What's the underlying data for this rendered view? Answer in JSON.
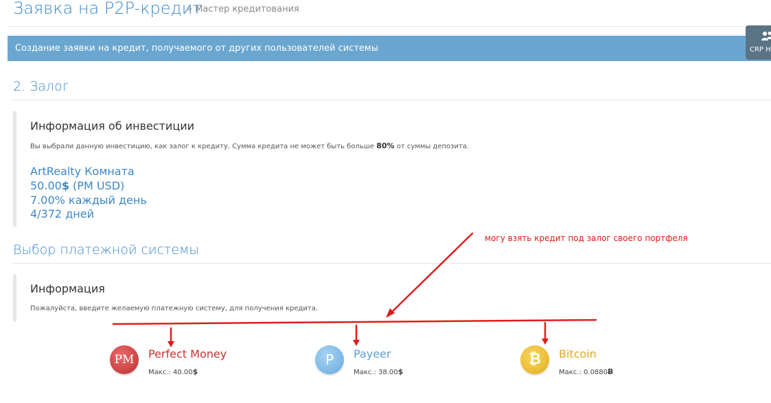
{
  "header": {
    "title": "Заявка на P2P-кредит",
    "breadcrumb": "» Мастер кредитования"
  },
  "banner": {
    "text": "Создание заявки на кредит, получаемого от других пользователей системы"
  },
  "side_tab": {
    "label": "CRP H",
    "icon": "users-icon"
  },
  "collateral": {
    "title_number": "2.",
    "title": "Залог",
    "info_heading": "Информация об инвестиции",
    "info_text_before": "Вы выбрали данную инвестицию, как залог к кредиту. Сумма кредита не может быть больше",
    "info_text_percent": "80%",
    "info_text_after": "от суммы депозита.",
    "investment": {
      "name": "ArtRealty Комната",
      "amount": "50.00",
      "currency_symbol": "$",
      "currency_note": "(PM USD)",
      "rate": "7.00% каждый день",
      "term": "4/372 дней"
    }
  },
  "payment": {
    "title": "Выбор платежной системы",
    "info_heading": "Информация",
    "info_text": "Пожалуйста, введите желаемую платежную систему, для получения кредита.",
    "options": [
      {
        "name": "Perfect Money",
        "icon_text": "PM",
        "max_label": "Макс.:",
        "max_value": "40.00",
        "max_symbol": "$",
        "color": "#c9302c"
      },
      {
        "name": "Payeer",
        "icon_text": "P",
        "max_label": "Макс.:",
        "max_value": "38.00",
        "max_symbol": "$",
        "color": "#5a9fd6"
      },
      {
        "name": "Bitcoin",
        "icon_text": "₿",
        "max_label": "Макс.:",
        "max_value": "0.0880",
        "max_symbol": "Ƀ",
        "color": "#e2a81c"
      }
    ]
  },
  "annotation": {
    "text": "могу взять кредит под залог своего портфеля",
    "color": "#e01b1b"
  }
}
